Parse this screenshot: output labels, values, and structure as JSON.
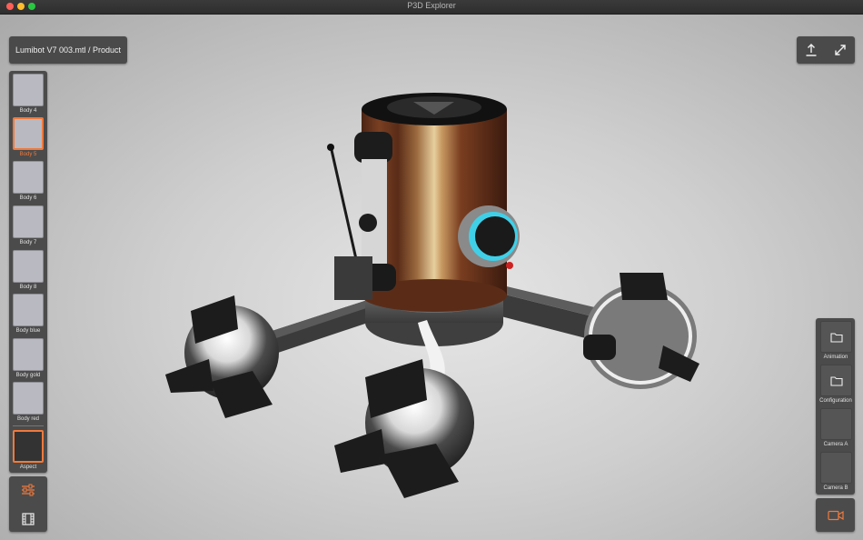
{
  "window": {
    "title": "P3D Explorer"
  },
  "breadcrumb": {
    "text": "Lumibot V7 003.mtl / Product"
  },
  "toolbar_right": {
    "icons": [
      "share-icon",
      "fullscreen-icon"
    ]
  },
  "materials": {
    "items": [
      {
        "label": "Body 4",
        "selected": false
      },
      {
        "label": "Body 5",
        "selected": true
      },
      {
        "label": "Body 6",
        "selected": false
      },
      {
        "label": "Body 7",
        "selected": false
      },
      {
        "label": "Body 8",
        "selected": false
      },
      {
        "label": "Body blue",
        "selected": false
      },
      {
        "label": "Body gold",
        "selected": false
      },
      {
        "label": "Body red",
        "selected": false
      }
    ],
    "aspect_label": "Aspect"
  },
  "left_tools": {
    "icons": [
      "sliders-icon",
      "film-icon"
    ]
  },
  "right_panel": {
    "items": [
      {
        "label": "Animation",
        "icon": "folder-icon"
      },
      {
        "label": "Configuration",
        "icon": "folder-icon"
      },
      {
        "label": "Camera A",
        "icon": ""
      },
      {
        "label": "Camera B",
        "icon": ""
      }
    ],
    "record_icon": "video-camera-icon"
  },
  "colors": {
    "accent": "#f07a3c",
    "panel": "#4b4b4b",
    "ring": "#3fd0e8"
  }
}
